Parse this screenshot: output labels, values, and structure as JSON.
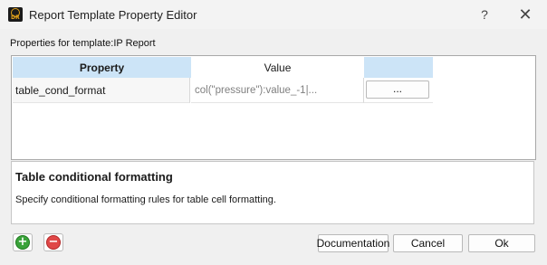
{
  "window": {
    "title": "Report Template Property Editor",
    "help_glyph": "?",
    "close_glyph": "✕",
    "app_icon_text": "DR"
  },
  "properties_label": "Properties for template:IP Report",
  "grid": {
    "columns": [
      "Property",
      "Value",
      ""
    ],
    "rows": [
      {
        "property": "table_cond_format",
        "value": "col(\"pressure\"):value_-1|...",
        "button_label": "..."
      }
    ],
    "header_color": "#cce4f7"
  },
  "description": {
    "title": "Table conditional formatting",
    "text": "Specify conditional formatting rules for table cell formatting."
  },
  "toolbar": {
    "add_glyph": "+",
    "remove_glyph": "−"
  },
  "buttons": {
    "documentation": "Documentation",
    "cancel": "Cancel",
    "ok": "Ok"
  }
}
